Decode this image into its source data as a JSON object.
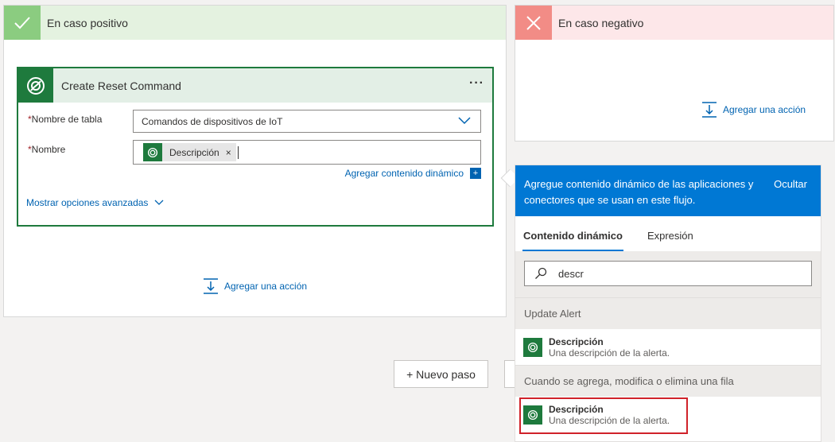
{
  "positive_branch": {
    "title": "En caso positivo",
    "add_action": "Agregar una acción"
  },
  "negative_branch": {
    "title": "En caso negativo",
    "add_action": "Agregar una acción"
  },
  "action_card": {
    "title": "Create Reset Command",
    "more": "···",
    "table_label": "Nombre de tabla",
    "table_value": "Comandos de dispositivos de IoT",
    "name_label": "Nombre",
    "name_token": "Descripción",
    "token_remove": "×",
    "required_mark": "*",
    "dynamic_link": "Agregar contenido dinámico",
    "advanced_link": "Mostrar opciones avanzadas"
  },
  "new_step": "+ Nuevo paso",
  "dynamic_panel": {
    "header_text": "Agregue contenido dinámico de las aplicaciones y conectores que se usan en este flujo.",
    "hide": "Ocultar",
    "tabs": [
      "Contenido dinámico",
      "Expresión"
    ],
    "search_value": "descr",
    "sections": [
      {
        "title": "Update Alert",
        "items": [
          {
            "name": "Descripción",
            "desc": "Una descripción de la alerta."
          }
        ]
      },
      {
        "title": "Cuando se agrega, modifica o elimina una fila",
        "items": [
          {
            "name": "Descripción",
            "desc": "Una descripción de la alerta."
          }
        ]
      }
    ]
  },
  "colors": {
    "accent": "#0078d4",
    "dataverse_green": "#1e7a3d",
    "positive": "#8bcc80",
    "negative": "#f28c86",
    "highlight": "#d0222a"
  },
  "icons": {
    "positive": "check-icon",
    "negative": "x-icon",
    "connector": "dataverse-icon",
    "search": "search-icon",
    "add_action": "add-action-icon"
  }
}
